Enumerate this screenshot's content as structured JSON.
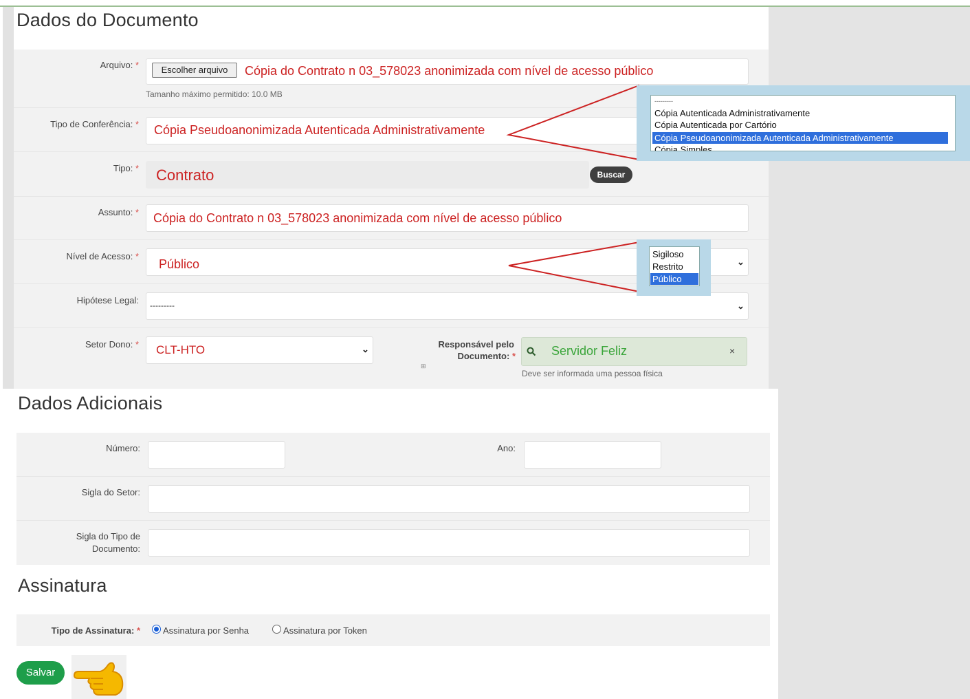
{
  "section1": {
    "title": "Dados do Documento",
    "arquivo": {
      "label": "Arquivo:",
      "button": "Escolher arquivo",
      "filename": "Cópia do Contrato n 03_578023 anonimizada com nível de acesso público",
      "help": "Tamanho máximo permitido: 10.0 MB"
    },
    "tipo_conferencia": {
      "label": "Tipo de Conferência:",
      "value": "Cópia Pseudoanonimizada Autenticada Administrativamente"
    },
    "tipo": {
      "label": "Tipo:",
      "value": "Contrato",
      "button": "Buscar"
    },
    "assunto": {
      "label": "Assunto:",
      "value": "Cópia do Contrato n 03_578023 anonimizada com nível de acesso público"
    },
    "nivel_acesso": {
      "label": "Nível de Acesso:",
      "value": "Público"
    },
    "hipotese_legal": {
      "label": "Hipótese Legal:",
      "value": "---------"
    },
    "setor_dono": {
      "label": "Setor Dono:",
      "value": "CLT-HTO"
    },
    "responsavel": {
      "label_line1": "Responsável pelo",
      "label_line2": "Documento:",
      "value": "Servidor Feliz",
      "clear": "×",
      "help": "Deve ser informada uma pessoa física"
    },
    "required_mark": "*"
  },
  "dropdown_conferencia": {
    "options": [
      "---------",
      "Cópia Autenticada Administrativamente",
      "Cópia Autenticada por Cartório",
      "Cópia Pseudoanonimizada Autenticada Administrativamente",
      "Cópia Simples"
    ],
    "selected": "Cópia Pseudoanonimizada Autenticada Administrativamente"
  },
  "dropdown_nivel": {
    "options": [
      "Sigiloso",
      "Restrito",
      "Público"
    ],
    "selected": "Público"
  },
  "section2": {
    "title": "Dados Adicionais",
    "numero_label": "Número:",
    "ano_label": "Ano:",
    "sigla_setor_label": "Sigla do Setor:",
    "sigla_tipo_label_line1": "Sigla do Tipo de",
    "sigla_tipo_label_line2": "Documento:"
  },
  "section3": {
    "title": "Assinatura",
    "tipo_label": "Tipo de Assinatura:",
    "option_senha": "Assinatura por Senha",
    "option_token": "Assinatura por Token",
    "selected": "Assinatura por Senha"
  },
  "save_button": "Salvar",
  "colors": {
    "annotation_red": "#cc2222",
    "save_green": "#1e9e4a",
    "responsible_green": "#3aa53a",
    "selection_blue": "#2f6fdc"
  },
  "icons": {
    "search": "search-icon",
    "pointing_hand": "pointing-hand-icon",
    "chevron": "chevron-down-icon"
  }
}
